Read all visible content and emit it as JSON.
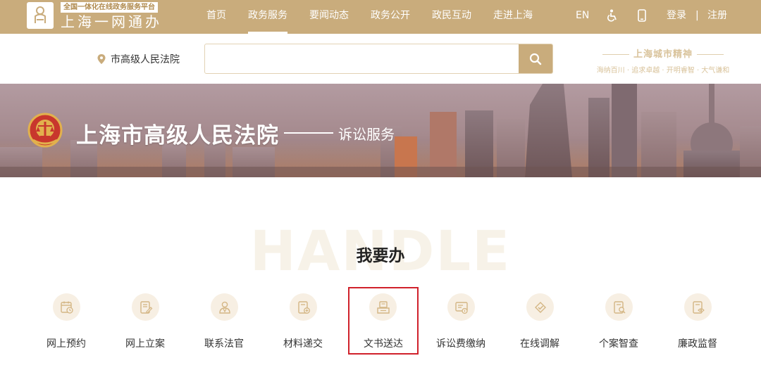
{
  "header": {
    "logo_badge": "全国一体化在线政务服务平台",
    "logo_text": "上海一网通办",
    "nav": [
      {
        "label": "首页",
        "active": false
      },
      {
        "label": "政务服务",
        "active": true
      },
      {
        "label": "要闻动态",
        "active": false
      },
      {
        "label": "政务公开",
        "active": false
      },
      {
        "label": "政民互动",
        "active": false
      },
      {
        "label": "走进上海",
        "active": false
      }
    ],
    "lang": "EN",
    "login": "登录",
    "divider": "|",
    "register": "注册"
  },
  "search": {
    "location": "市高级人民法院",
    "placeholder": "",
    "value": ""
  },
  "spirit": {
    "title": "上海城市精神",
    "subtitle": "海纳百川 · 追求卓越 · 开明睿智 · 大气谦和"
  },
  "banner": {
    "court_name": "上海市高级人民法院",
    "service": "诉讼服务"
  },
  "section": {
    "watermark": "HANDLE",
    "title": "我要办"
  },
  "services": [
    {
      "label": "网上预约",
      "icon": "calendar-clock-icon"
    },
    {
      "label": "网上立案",
      "icon": "document-edit-icon"
    },
    {
      "label": "联系法官",
      "icon": "judge-icon"
    },
    {
      "label": "材料递交",
      "icon": "document-add-icon"
    },
    {
      "label": "文书送达",
      "icon": "document-delivery-icon",
      "highlighted": true
    },
    {
      "label": "诉讼费缴纳",
      "icon": "fee-payment-icon"
    },
    {
      "label": "在线调解",
      "icon": "mediation-icon"
    },
    {
      "label": "个案智查",
      "icon": "case-search-icon"
    },
    {
      "label": "廉政监督",
      "icon": "supervision-icon"
    }
  ],
  "colors": {
    "brand_gold": "#c9ac7c",
    "highlight_red": "#d0212b",
    "icon_bg": "#f7efe3"
  }
}
